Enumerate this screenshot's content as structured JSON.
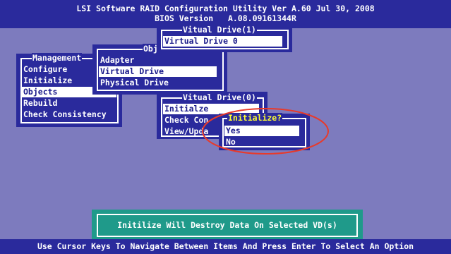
{
  "header": {
    "line1": "LSI Software RAID Configuration Utility Ver A.60 Jul 30, 2008",
    "line2": "BIOS Version   A.08.09161344R"
  },
  "management_menu": {
    "title": "Management",
    "items": [
      "Configure",
      "Initialize",
      "Objects",
      "Rebuild",
      "Check Consistency"
    ],
    "selected": "Objects"
  },
  "objects_menu": {
    "title": "Obj",
    "items": [
      "Adapter",
      "Virtual Drive",
      "Physical Drive"
    ],
    "selected": "Virtual Drive"
  },
  "virtual_drive_list": {
    "title": "Vitual Drive(1)",
    "items": [
      "Virtual Drive 0"
    ],
    "selected": "Virtual Drive 0"
  },
  "vd0_menu": {
    "title": "Vitual Drive(0)",
    "items": [
      "Initialze",
      "Check Con",
      "View/Upda"
    ],
    "selected": "Initialze"
  },
  "initialize_dialog": {
    "title": "Initialize?",
    "options": [
      "Yes",
      "No"
    ],
    "selected": "Yes"
  },
  "warning": "Initilize Will Destroy Data On Selected VD(s)",
  "status_bar": "Use Cursor Keys To Navigate Between Items And Press Enter To Select An Option",
  "colors": {
    "desktop": "#7d7bbe",
    "window": "#2a2a9c",
    "highlight_text": "#1a1a8a",
    "dialog_title": "#ffff33",
    "warning_bg": "#1f9a8a",
    "annotation_ring": "#e83a2a"
  }
}
